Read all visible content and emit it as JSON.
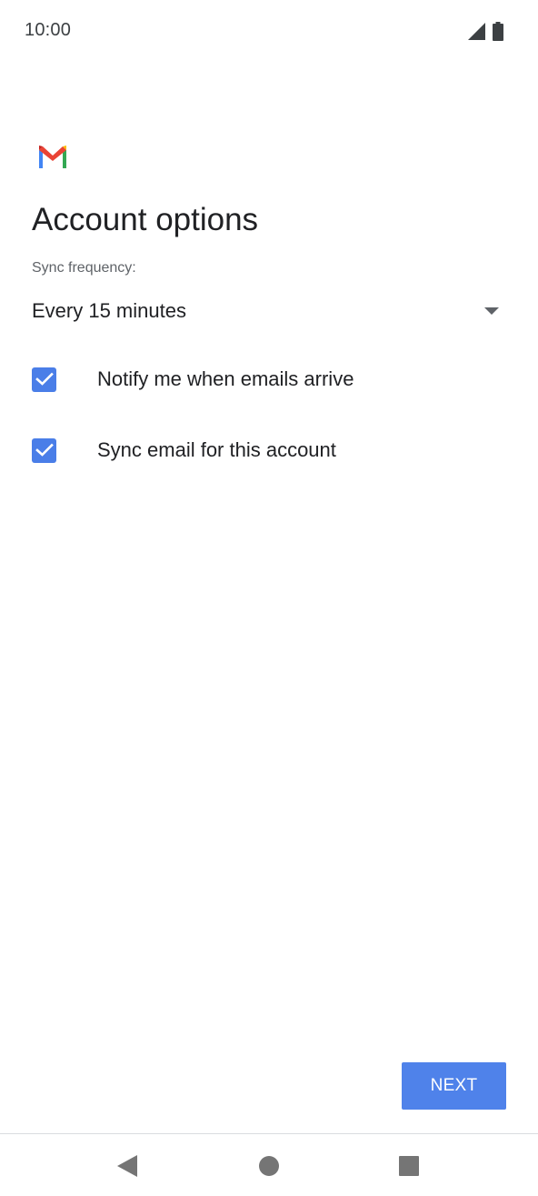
{
  "status_bar": {
    "time": "10:00",
    "icons": [
      "signal-icon",
      "battery-icon"
    ]
  },
  "logo": {
    "icon": "gmail-logo-icon",
    "colors": [
      "#4285F4",
      "#EA4335",
      "#FBBC05",
      "#34A853",
      "#C5221F"
    ]
  },
  "main": {
    "title": "Account options",
    "sync_label": "Sync frequency:",
    "sync_value": "Every 15 minutes",
    "checkboxes": [
      {
        "label": "Notify me when emails arrive",
        "checked": true
      },
      {
        "label": "Sync email for this account",
        "checked": true
      }
    ]
  },
  "actions": {
    "next_label": "NEXT"
  },
  "nav_bar": {
    "icons": [
      "back-icon",
      "home-icon",
      "recents-icon"
    ]
  },
  "colors": {
    "accent": "#4F82EA",
    "checkbox": "#4A7EE8",
    "text_primary": "#202124",
    "text_secondary": "#5F6368"
  }
}
